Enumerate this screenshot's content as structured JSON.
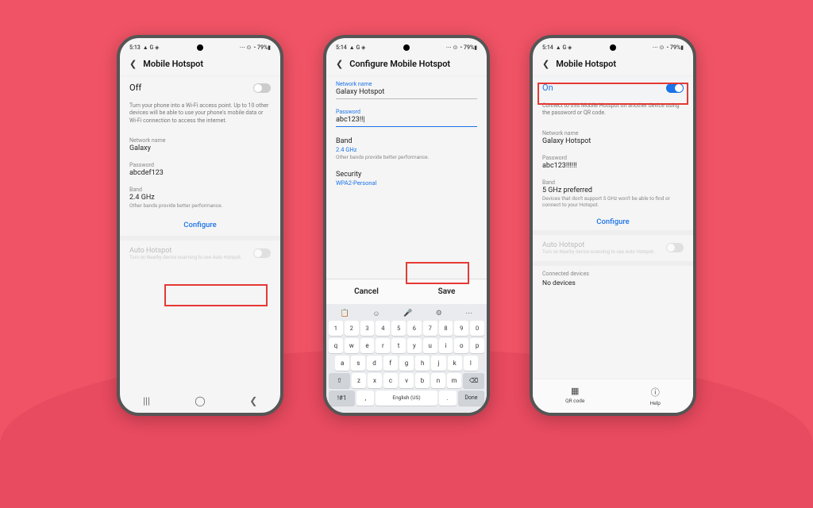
{
  "status": {
    "time": "5:13",
    "time2": "5:14",
    "time3": "5:14",
    "left_icons": "▲ G ◈",
    "right_icons": "⋯ ⊙ ◔ 79%▮"
  },
  "phone1": {
    "title": "Mobile Hotspot",
    "toggle_label": "Off",
    "desc": "Turn your phone into a Wi-Fi access point. Up to 10 other devices will be able to use your phone's mobile data or Wi-Fi connection to access the internet.",
    "net_label": "Network name",
    "net_value": "Galaxy",
    "pwd_label": "Password",
    "pwd_value": "abcdef123",
    "band_label": "Band",
    "band_value": "2.4 GHz",
    "band_sub": "Other bands provide better performance.",
    "configure": "Configure",
    "auto_label": "Auto Hotspot",
    "auto_sub": "Turn on Nearby device scanning to use Auto Hotspot."
  },
  "phone2": {
    "title": "Configure Mobile Hotspot",
    "net_label": "Network name",
    "net_value": "Galaxy Hotspot",
    "pwd_label": "Password",
    "pwd_value": "abc123!!|",
    "band_label": "Band",
    "band_value": "2.4 GHz",
    "band_sub": "Other bands provide better performance.",
    "sec_label": "Security",
    "sec_value": "WPA2-Personal",
    "cancel": "Cancel",
    "save": "Save",
    "kbd": {
      "row_num": [
        "1",
        "2",
        "3",
        "4",
        "5",
        "6",
        "7",
        "8",
        "9",
        "0"
      ],
      "row1": [
        "q",
        "w",
        "e",
        "r",
        "t",
        "y",
        "u",
        "i",
        "o",
        "p"
      ],
      "row2": [
        "a",
        "s",
        "d",
        "f",
        "g",
        "h",
        "j",
        "k",
        "l"
      ],
      "row3": [
        "⇧",
        "z",
        "x",
        "c",
        "v",
        "b",
        "n",
        "m",
        "⌫"
      ],
      "row4_sym": "!#1",
      "row4_comma": ",",
      "row4_space": "English (US)",
      "row4_dot": ".",
      "row4_done": "Done"
    }
  },
  "phone3": {
    "title": "Mobile Hotspot",
    "toggle_label": "On",
    "desc": "Connect to this Mobile Hotspot on another device using the password or QR code.",
    "net_label": "Network name",
    "net_value": "Galaxy Hotspot",
    "pwd_label": "Password",
    "pwd_value": "abc123!!!!!!",
    "band_label": "Band",
    "band_value": "5 GHz preferred",
    "band_sub": "Devices that don't support 5 GHz won't be able to find or connect to your Hotspot.",
    "configure": "Configure",
    "auto_label": "Auto Hotspot",
    "auto_sub": "Turn on Nearby device scanning to use Auto Hotspot.",
    "connected_label": "Connected devices",
    "connected_value": "No devices",
    "action_qr": "QR code",
    "action_help": "Help"
  }
}
